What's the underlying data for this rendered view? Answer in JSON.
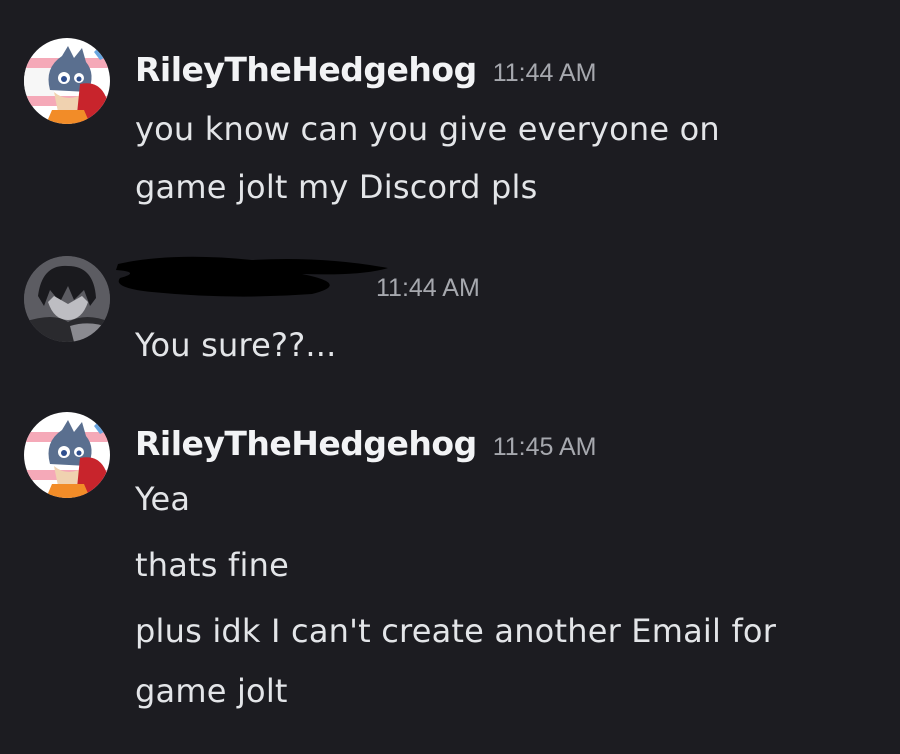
{
  "messages": [
    {
      "author": "RileyTheHedgehog",
      "timestamp": "11:44 AM",
      "avatar_icon": "hedgehog-avatar-icon",
      "lines": [
        "you know can you give everyone on",
        "game jolt my Discord pls"
      ]
    },
    {
      "author": "",
      "timestamp": "11:44 AM",
      "avatar_icon": "dark-haired-avatar-icon",
      "lines": [
        "You sure??..."
      ]
    },
    {
      "author": "RileyTheHedgehog",
      "timestamp": "11:45 AM",
      "avatar_icon": "hedgehog-avatar-icon",
      "lines": [
        "Yea",
        "thats fine",
        "plus idk I can't create another Email for",
        "game jolt"
      ]
    }
  ],
  "colors": {
    "background": "#1c1c21",
    "username": "#f2f3f5",
    "timestamp": "#a6a8ae",
    "message_text": "#e3e5e8"
  }
}
